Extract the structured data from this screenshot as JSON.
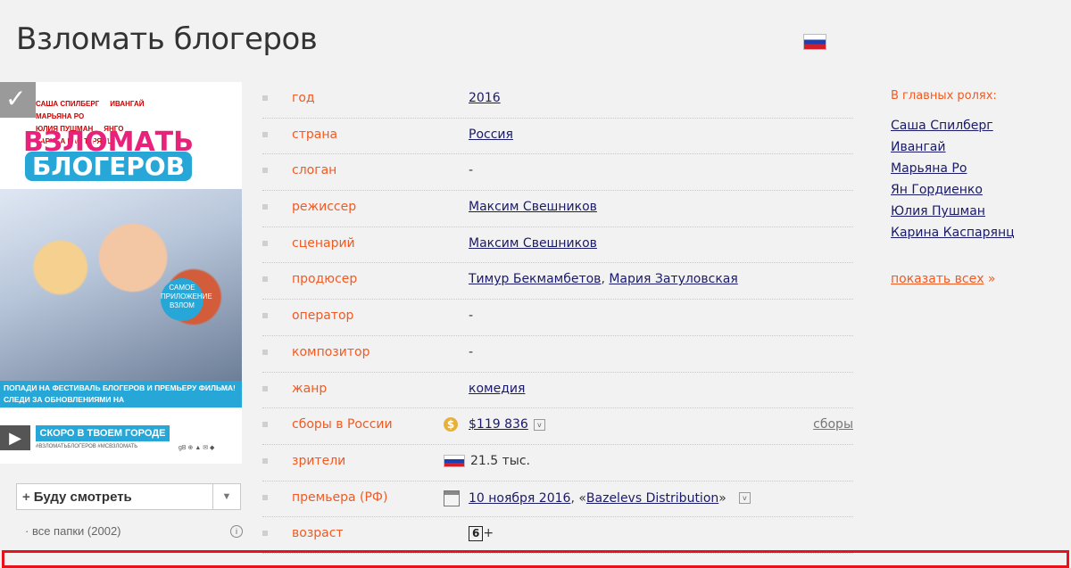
{
  "page": {
    "title": "Взломать блогеров"
  },
  "poster": {
    "cast_names": [
      "САША СПИЛБЕРГ",
      "ИВАНГАЙ",
      "МАРЬЯНА РО",
      "ЮЛИЯ ПУШМАН",
      "ЯНГО",
      "КАРИНА КАСПАРЯНЦ"
    ],
    "title_line1": "ВЗЛОМАТЬ",
    "title_line2": "БЛОГЕРОВ",
    "bubble_text": "САМОЕ ПРИЛОЖЕНИЕ ВЗЛОМ",
    "band_line1": "ПОПАДИ НА ФЕСТИВАЛЬ БЛОГЕРОВ И ПРЕМЬЕРУ ФИЛЬМА!",
    "band_line2": "СЛЕДИ ЗА ОБНОВЛЕНИЯМИ НА VK.COM/VZLOMAT_BLOGEROV",
    "soon": "СКОРО В ТВОЕМ ГОРОДЕ",
    "tags": "#ВЗЛОМАТЬБЛОГЕРОВ #МСВЗЛОМАТЬ",
    "logos": "gB ⊕ ▲ ✉ ◆"
  },
  "watch": {
    "plus": "+",
    "label": "Буду смотреть",
    "arrow": "▼",
    "folders": "все папки (2002)",
    "info": "i"
  },
  "info_rows": [
    {
      "label": "год",
      "value": "2016"
    },
    {
      "label": "страна",
      "value": "Россия"
    },
    {
      "label": "слоган",
      "value": "-"
    },
    {
      "label": "режиссер",
      "value": "Максим Свешников"
    },
    {
      "label": "сценарий",
      "value": "Максим Свешников"
    },
    {
      "label": "продюсер",
      "value1": "Тимур Бекмамбетов",
      "sep": ", ",
      "value2": "Мария Затуловская"
    },
    {
      "label": "оператор",
      "value": "-"
    },
    {
      "label": "композитор",
      "value": "-"
    },
    {
      "label": "жанр",
      "value": "комедия"
    },
    {
      "label": "сборы в России",
      "icon": "$",
      "value": "$119 836",
      "link": "сборы",
      "drop": "v"
    },
    {
      "label": "зрители",
      "value": "21.5 тыс."
    },
    {
      "label": "премьера (РФ)",
      "date": "10 ноября 2016",
      "sep": ", «",
      "distributor": "Bazelevs Distribution",
      "close": "»",
      "drop": "v"
    },
    {
      "label": "возраст",
      "age": "6",
      "plus": "+"
    }
  ],
  "cast": {
    "heading": "В главных ролях:",
    "actors": [
      "Саша Спилберг",
      "Ивангай",
      "Марьяна Ро",
      "Ян Гордиенко",
      "Юлия Пушман",
      "Карина Каспарянц"
    ],
    "show_all": "показать всех",
    "show_all_arrow": " »"
  },
  "colors": {
    "accent": "#f15a22",
    "link": "#1a1a6a",
    "highlight": "#e8121a"
  }
}
